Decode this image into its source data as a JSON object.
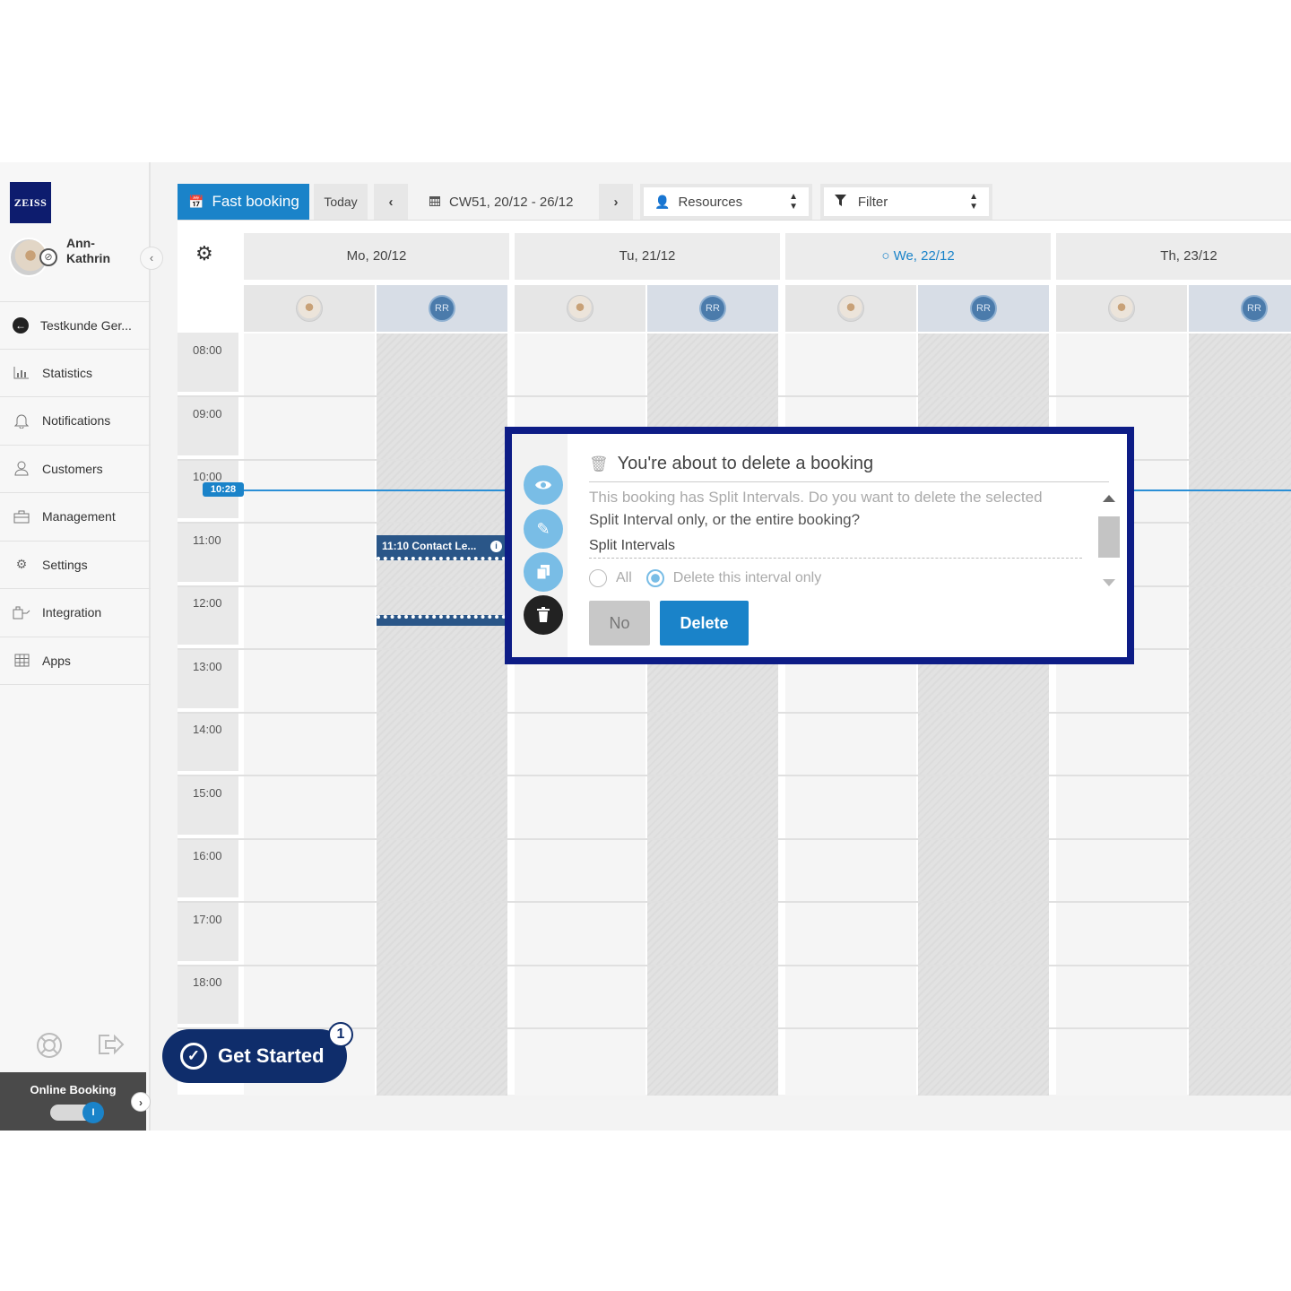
{
  "brand": {
    "logo_text": "ZEISS"
  },
  "user": {
    "name": "Ann-\nKathrin"
  },
  "sidebar": {
    "items": [
      {
        "label": "Testkunde Ger...",
        "icon": "customer-circle-icon"
      },
      {
        "label": "Statistics",
        "icon": "bar-chart-icon"
      },
      {
        "label": "Notifications",
        "icon": "bell-icon"
      },
      {
        "label": "Customers",
        "icon": "person-icon"
      },
      {
        "label": "Management",
        "icon": "briefcase-icon"
      },
      {
        "label": "Settings",
        "icon": "gears-icon"
      },
      {
        "label": "Integration",
        "icon": "plug-icon"
      },
      {
        "label": "Apps",
        "icon": "grid-icon"
      }
    ],
    "online_booking_label": "Online Booking",
    "online_booking_enabled": true
  },
  "toolbar": {
    "fast_booking": "Fast booking",
    "today": "Today",
    "week": "CW51, 20/12 - 26/12",
    "resources": "Resources",
    "filter": "Filter"
  },
  "calendar": {
    "days": [
      {
        "label": "Mo, 20/12",
        "today": false
      },
      {
        "label": "Tu, 21/12",
        "today": false
      },
      {
        "label": "We, 22/12",
        "today": true
      },
      {
        "label": "Th, 23/12",
        "today": false
      }
    ],
    "resource_initials": "RR",
    "hours": [
      "08:00",
      "09:00",
      "10:00",
      "11:00",
      "12:00",
      "13:00",
      "14:00",
      "15:00",
      "16:00",
      "17:00",
      "18:00"
    ],
    "now": "10:28",
    "booking": {
      "label": "11:10 Contact Le..."
    }
  },
  "dialog": {
    "title": "You're about to delete a booking",
    "message_faded": "This booking has Split Intervals. Do you want to delete the selected",
    "message": "Split Interval only, or the entire booking?",
    "section_label": "Split Intervals",
    "option_all": "All",
    "option_interval": "Delete this interval only",
    "no_label": "No",
    "delete_label": "Delete"
  },
  "get_started": {
    "label": "Get Started",
    "badge": "1"
  },
  "colors": {
    "primary": "#1a83c9",
    "dialog_border": "#0d1c86",
    "navy": "#0f2d6b"
  }
}
